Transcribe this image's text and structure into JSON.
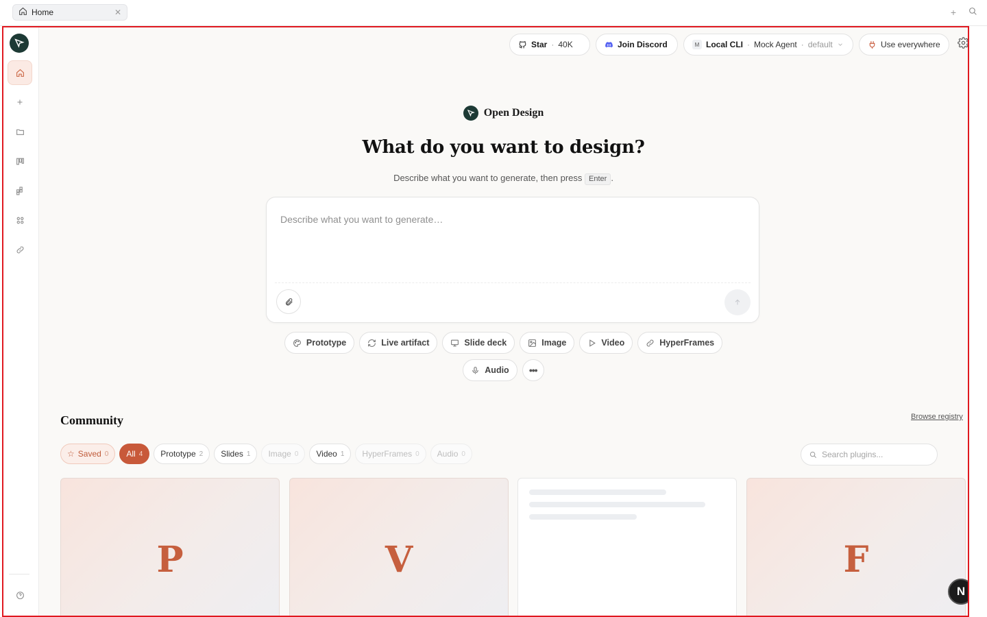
{
  "tabbar": {
    "tab_label": "Home"
  },
  "toolbar": {
    "star_label": "Star",
    "star_count": "40K",
    "discord_label": "Join Discord",
    "agent_source": "Local CLI",
    "agent_name": "Mock Agent",
    "agent_profile": "default",
    "use_everywhere_label": "Use everywhere"
  },
  "hero": {
    "brand_name": "Open Design",
    "headline": "What do you want to design?",
    "subline_prefix": "Describe what you want to generate, then press",
    "subline_key": "Enter",
    "subline_suffix": "."
  },
  "composer": {
    "placeholder": "Describe what you want to generate…"
  },
  "modes": [
    {
      "label": "Prototype",
      "icon": "palette-icon"
    },
    {
      "label": "Live artifact",
      "icon": "refresh-icon"
    },
    {
      "label": "Slide deck",
      "icon": "monitor-icon"
    },
    {
      "label": "Image",
      "icon": "image-icon"
    },
    {
      "label": "Video",
      "icon": "play-icon"
    },
    {
      "label": "HyperFrames",
      "icon": "link-icon"
    },
    {
      "label": "Audio",
      "icon": "microphone-icon"
    }
  ],
  "community": {
    "title": "Community",
    "browse_label": "Browse registry",
    "search_placeholder": "Search plugins...",
    "filters": [
      {
        "label": "Saved",
        "count": "0"
      },
      {
        "label": "All",
        "count": "4"
      },
      {
        "label": "Prototype",
        "count": "2"
      },
      {
        "label": "Slides",
        "count": "1"
      },
      {
        "label": "Image",
        "count": "0"
      },
      {
        "label": "Video",
        "count": "1"
      },
      {
        "label": "HyperFrames",
        "count": "0"
      },
      {
        "label": "Audio",
        "count": "0"
      }
    ],
    "cards": [
      {
        "letter": "P"
      },
      {
        "letter": "V"
      },
      {
        "letter": ""
      },
      {
        "letter": "F"
      }
    ]
  },
  "fab": {
    "label": "N"
  },
  "colors": {
    "accent": "#c8593a",
    "brand_dark": "#1d3a35",
    "frame_border": "#e0181f"
  }
}
